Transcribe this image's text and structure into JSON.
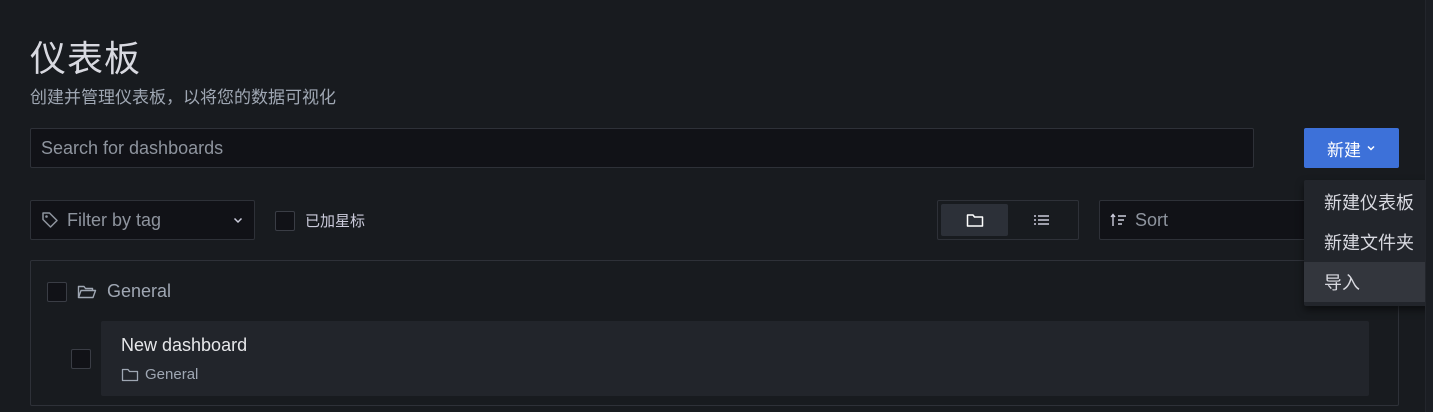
{
  "page": {
    "title": "仪表板",
    "subtitle": "创建并管理仪表板，以将您的数据可视化"
  },
  "search": {
    "placeholder": "Search for dashboards"
  },
  "new_button": {
    "label": "新建"
  },
  "new_menu": {
    "items": [
      {
        "label": "新建仪表板"
      },
      {
        "label": "新建文件夹"
      },
      {
        "label": "导入",
        "highlighted": true
      }
    ]
  },
  "filters": {
    "tag_placeholder": "Filter by tag",
    "starred_label": "已加星标",
    "sort_placeholder": "Sort"
  },
  "view_mode": {
    "options": [
      "folder-view",
      "list-view"
    ],
    "selected": "folder-view"
  },
  "list": {
    "folder": {
      "name": "General"
    },
    "dashboards": [
      {
        "title": "New dashboard",
        "folder": "General"
      }
    ]
  },
  "colors": {
    "background": "#181b1f",
    "primary_button": "#3d71d9",
    "menu_background": "#22252b"
  }
}
